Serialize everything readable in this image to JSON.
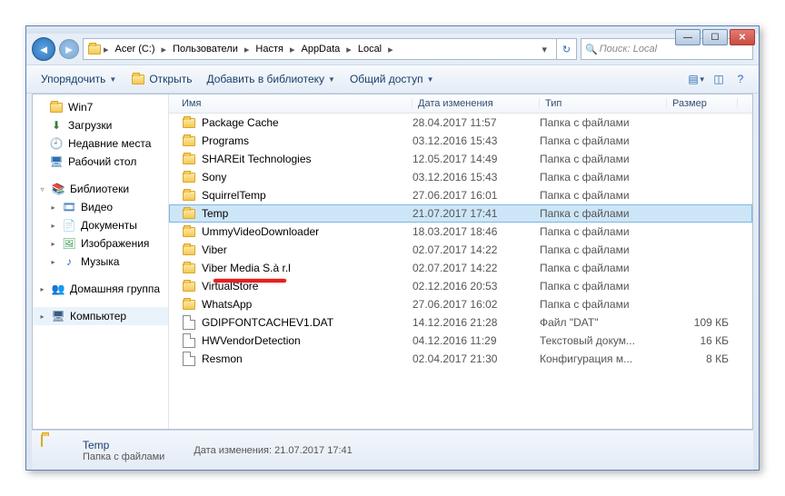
{
  "win_controls": {
    "min": "—",
    "max": "☐",
    "close": "✕"
  },
  "breadcrumb": [
    "Acer (C:)",
    "Пользователи",
    "Настя",
    "AppData",
    "Local"
  ],
  "search": {
    "placeholder": "Поиск: Local"
  },
  "toolbar": {
    "organize": "Упорядочить",
    "open": "Открыть",
    "addlib": "Добавить в библиотеку",
    "share": "Общий доступ"
  },
  "sidebar": {
    "items1": [
      "Win7",
      "Загрузки",
      "Недавние места",
      "Рабочий стол"
    ],
    "libraries": "Библиотеки",
    "libs": [
      "Видео",
      "Документы",
      "Изображения",
      "Музыка"
    ],
    "homegroup": "Домашняя группа",
    "computer": "Компьютер"
  },
  "columns": [
    "Имя",
    "Дата изменения",
    "Тип",
    "Размер"
  ],
  "rows": [
    {
      "icon": "folder",
      "name": "Package Cache",
      "date": "28.04.2017 11:57",
      "type": "Папка с файлами",
      "size": ""
    },
    {
      "icon": "folder",
      "name": "Programs",
      "date": "03.12.2016 15:43",
      "type": "Папка с файлами",
      "size": ""
    },
    {
      "icon": "folder",
      "name": "SHAREit Technologies",
      "date": "12.05.2017 14:49",
      "type": "Папка с файлами",
      "size": ""
    },
    {
      "icon": "folder",
      "name": "Sony",
      "date": "03.12.2016 15:43",
      "type": "Папка с файлами",
      "size": ""
    },
    {
      "icon": "folder",
      "name": "SquirrelTemp",
      "date": "27.06.2017 16:01",
      "type": "Папка с файлами",
      "size": ""
    },
    {
      "icon": "folder",
      "name": "Temp",
      "date": "21.07.2017 17:41",
      "type": "Папка с файлами",
      "size": "",
      "selected": true
    },
    {
      "icon": "folder",
      "name": "UmmyVideoDownloader",
      "date": "18.03.2017 18:46",
      "type": "Папка с файлами",
      "size": ""
    },
    {
      "icon": "folder",
      "name": "Viber",
      "date": "02.07.2017 14:22",
      "type": "Папка с файлами",
      "size": ""
    },
    {
      "icon": "folder",
      "name": "Viber Media S.à r.l",
      "date": "02.07.2017 14:22",
      "type": "Папка с файлами",
      "size": ""
    },
    {
      "icon": "folder",
      "name": "VirtualStore",
      "date": "02.12.2016 20:53",
      "type": "Папка с файлами",
      "size": ""
    },
    {
      "icon": "folder",
      "name": "WhatsApp",
      "date": "27.06.2017 16:02",
      "type": "Папка с файлами",
      "size": ""
    },
    {
      "icon": "file",
      "name": "GDIPFONTCACHEV1.DAT",
      "date": "14.12.2016 21:28",
      "type": "Файл \"DAT\"",
      "size": "109 КБ"
    },
    {
      "icon": "file",
      "name": "HWVendorDetection",
      "date": "04.12.2016 11:29",
      "type": "Текстовый докум...",
      "size": "16 КБ"
    },
    {
      "icon": "file",
      "name": "Resmon",
      "date": "02.04.2017 21:30",
      "type": "Конфигурация м...",
      "size": "8 КБ"
    }
  ],
  "details": {
    "name": "Temp",
    "type": "Папка с файлами",
    "meta_label": "Дата изменения:",
    "meta_value": "21.07.2017 17:41"
  }
}
